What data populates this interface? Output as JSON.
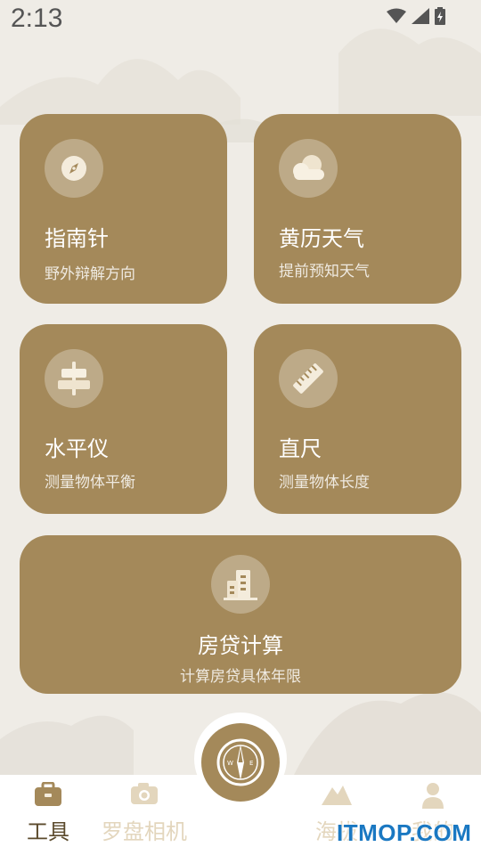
{
  "status_bar": {
    "time": "2:13"
  },
  "cards": [
    {
      "title": "指南针",
      "subtitle": "野外辩解方向",
      "icon": "compass-icon"
    },
    {
      "title": "黄历天气",
      "subtitle": "提前预知天气",
      "icon": "cloud-icon"
    },
    {
      "title": "水平仪",
      "subtitle": "测量物体平衡",
      "icon": "level-icon"
    },
    {
      "title": "直尺",
      "subtitle": "测量物体长度",
      "icon": "ruler-icon"
    },
    {
      "title": "房贷计算",
      "subtitle": "计算房贷具体年限",
      "icon": "building-icon"
    }
  ],
  "tabbar": {
    "items": [
      {
        "label": "工具",
        "icon": "briefcase-icon",
        "active": true
      },
      {
        "label": "罗盘相机",
        "icon": "camera-icon",
        "active": false
      },
      {
        "label": "海拔",
        "icon": "mountain-icon",
        "active": false
      },
      {
        "label": "我的",
        "icon": "person-icon",
        "active": false
      }
    ],
    "center_icon": "compass-icon"
  },
  "watermark": "ITMOP.COM",
  "colors": {
    "card": "#a4895a",
    "background": "#efece6",
    "tab_active": "#5b4a2c",
    "tab_inactive": "#e3d6bd"
  }
}
